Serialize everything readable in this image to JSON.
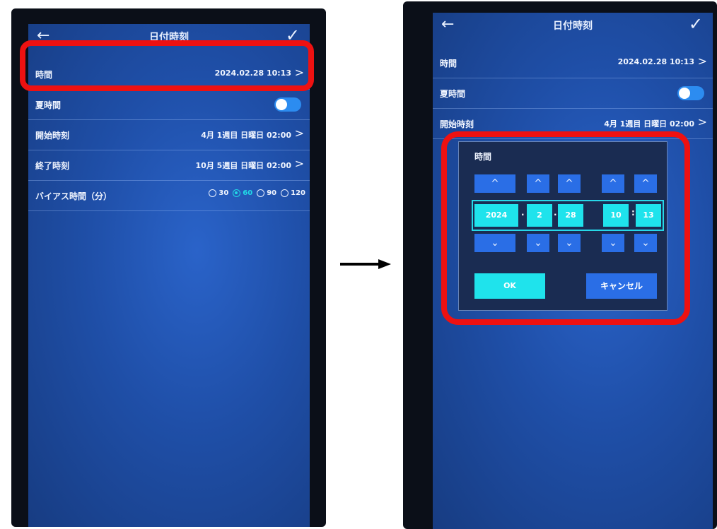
{
  "left_screen": {
    "header": {
      "title": "日付時刻",
      "back_icon": "arrow-left-icon",
      "confirm_icon": "check-icon"
    },
    "rows": {
      "time": {
        "label": "時間",
        "value": "2024.02.28 10:13"
      },
      "dst": {
        "label": "夏時間",
        "toggle_on": true
      },
      "start": {
        "label": "開始時刻",
        "value": "4月 1週目 日曜日 02:00"
      },
      "end": {
        "label": "終了時刻",
        "value": "10月 5週目 日曜日 02:00"
      },
      "bias": {
        "label": "バイアス時間（分）",
        "options": [
          "30",
          "60",
          "90",
          "120"
        ],
        "selected": "60"
      }
    }
  },
  "right_screen": {
    "header": {
      "title": "日付時刻"
    },
    "rows": {
      "time": {
        "label": "時間",
        "value": "2024.02.28 10:13"
      },
      "dst": {
        "label": "夏時間"
      },
      "start": {
        "label": "開始時刻",
        "value": "4月 1週目 日曜日 02:00"
      }
    },
    "dialog": {
      "title": "時間",
      "year": "2024",
      "month": "2",
      "day": "28",
      "hour": "10",
      "minute": "13",
      "date_sep": ".",
      "time_sep": ":",
      "ok_label": "OK",
      "cancel_label": "キャンセル"
    }
  },
  "colors": {
    "highlight": "#ee1111",
    "accent": "#1fe3ec",
    "screen_blue": "#1f4fa8"
  }
}
